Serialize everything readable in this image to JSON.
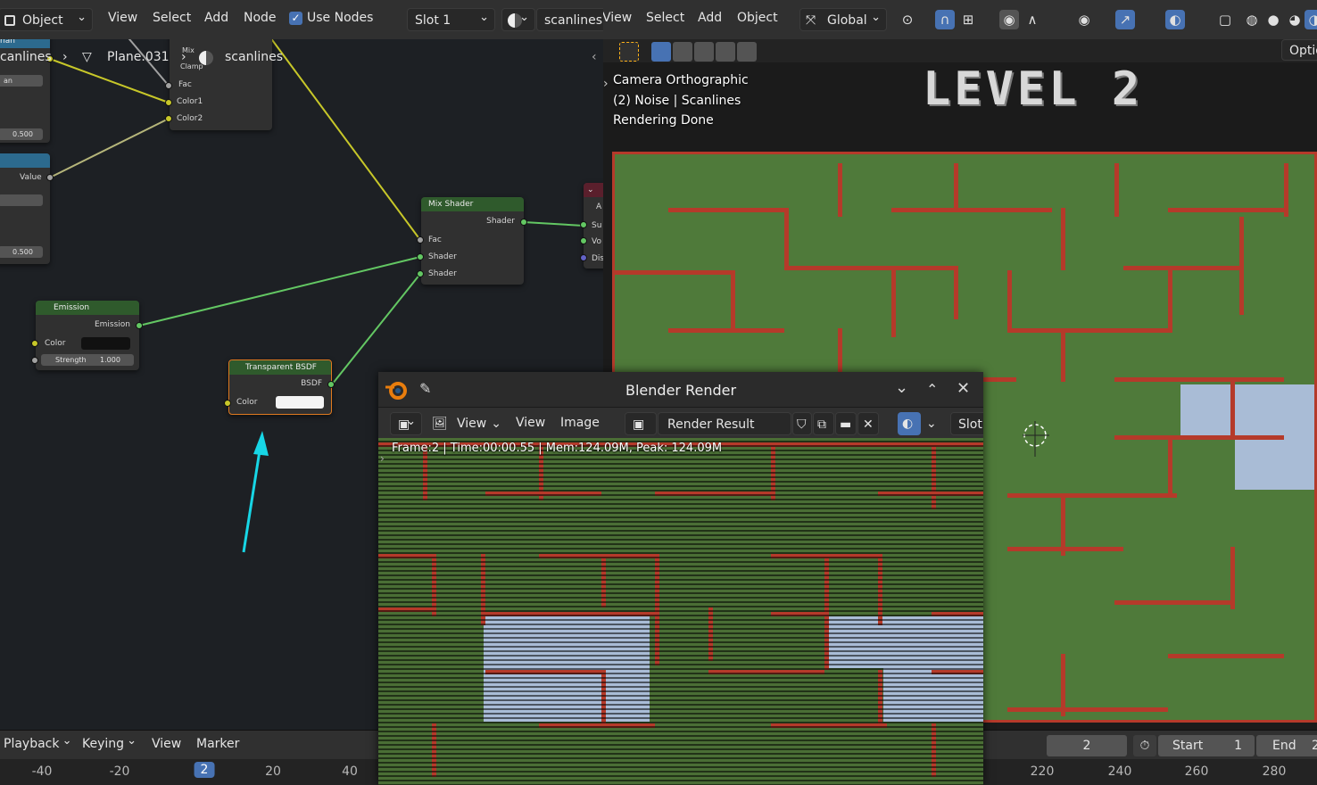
{
  "node_editor": {
    "header": {
      "mode": "Object",
      "menus": [
        "View",
        "Select",
        "Add",
        "Node"
      ],
      "use_nodes_label": "Use Nodes",
      "slot": "Slot 1",
      "material": "scanlines"
    },
    "breadcrumb": {
      "left": "canlines",
      "object": "Plane.031",
      "material": "scanlines"
    },
    "nodes": {
      "mix": {
        "title": "Mix",
        "clamp": "Clamp",
        "inputs": [
          "Fac",
          "Color1",
          "Color2"
        ]
      },
      "left_partial_1": {
        "title": "han",
        "value": "0.500",
        "dropdown": "an"
      },
      "left_partial_2": {
        "output": "Value",
        "value": "0.500"
      },
      "mix_shader": {
        "title": "Mix Shader",
        "output": "Shader",
        "inputs": [
          "Fac",
          "Shader",
          "Shader"
        ]
      },
      "output_partial": {
        "inputs": [
          "Su",
          "Vo",
          "Dis"
        ],
        "top": "A"
      },
      "emission": {
        "title": "Emission",
        "output": "Emission",
        "color_label": "Color",
        "strength_label": "Strength",
        "strength_value": "1.000"
      },
      "transparent": {
        "title": "Transparent BSDF",
        "output": "BSDF",
        "color_label": "Color"
      }
    },
    "colors": {
      "arrow": "#17d6e6"
    }
  },
  "viewport": {
    "header": {
      "menus": [
        "View",
        "Select",
        "Add",
        "Object"
      ],
      "orientation": "Global",
      "options": "Optio"
    },
    "overlay": {
      "line1": "Camera Orthographic",
      "line2": "(2) Noise | Scanlines",
      "line3": "Rendering Done"
    },
    "level_title": "LEVEL 2"
  },
  "render_window": {
    "title": "Blender Render",
    "toolbar": {
      "view1": "View",
      "view2": "View",
      "image": "Image",
      "result": "Render Result",
      "slot": "Slot"
    },
    "info": "Frame:2 | Time:00:00.55 | Mem:124.09M, Peak: 124.09M"
  },
  "timeline": {
    "menus": [
      "Playback",
      "Keying",
      "View",
      "Marker"
    ],
    "current_frame": "2",
    "start_label": "Start",
    "start_value": "1",
    "end_label": "End",
    "end_value": "2",
    "ticks_left": [
      "-40",
      "-20",
      "2",
      "20",
      "40"
    ],
    "ticks_right": [
      "220",
      "240",
      "260",
      "280"
    ]
  }
}
